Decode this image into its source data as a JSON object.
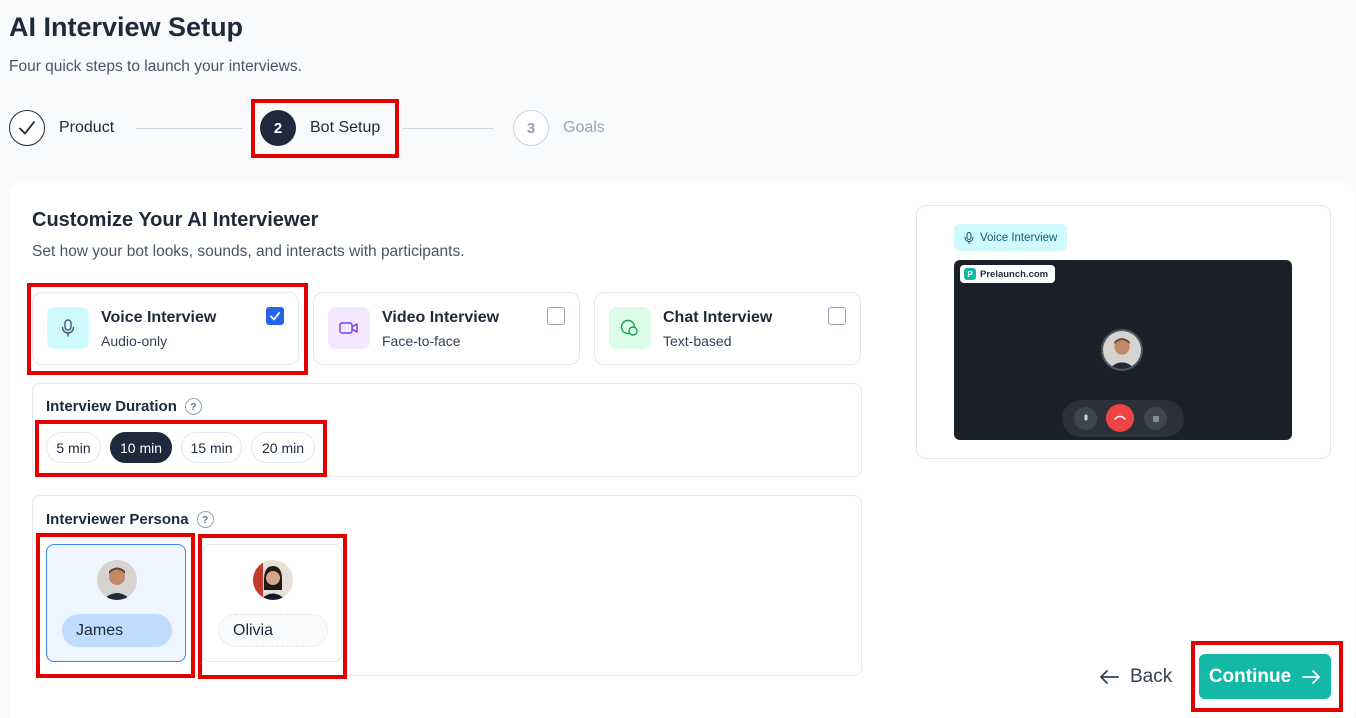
{
  "header": {
    "title": "AI Interview Setup",
    "subtitle": "Four quick steps to launch your interviews."
  },
  "stepper": {
    "steps": [
      {
        "number": "",
        "label": "Product",
        "state": "completed",
        "icon": "check-icon"
      },
      {
        "number": "2",
        "label": "Bot Setup",
        "state": "active"
      },
      {
        "number": "3",
        "label": "Goals",
        "state": "upcoming"
      }
    ]
  },
  "customize": {
    "title": "Customize Your AI Interviewer",
    "subtitle": "Set how your bot looks, sounds, and interacts with participants."
  },
  "modes": [
    {
      "title": "Voice Interview",
      "desc": "Audio-only",
      "icon": "microphone-icon",
      "checked": true,
      "icon_bg": "#cffafe"
    },
    {
      "title": "Video Interview",
      "desc": "Face-to-face",
      "icon": "video-camera-icon",
      "checked": false,
      "icon_bg": "#f3e8ff"
    },
    {
      "title": "Chat Interview",
      "desc": "Text-based",
      "icon": "chat-bubble-icon",
      "checked": false,
      "icon_bg": "#dcfce7"
    }
  ],
  "duration": {
    "label": "Interview Duration",
    "help": "?",
    "options": [
      "5 min",
      "10 min",
      "15 min",
      "20 min"
    ],
    "selected": "10 min"
  },
  "persona": {
    "label": "Interviewer Persona",
    "help": "?",
    "options": [
      {
        "name": "James",
        "selected": true
      },
      {
        "name": "Olivia",
        "selected": false
      }
    ]
  },
  "preview": {
    "badge": "Voice Interview",
    "brand": "Prelaunch.com",
    "brand_logo": "P"
  },
  "footer": {
    "back_label": "Back",
    "continue_label": "Continue"
  },
  "colors": {
    "accent": "#14b8a6",
    "dark": "#1e293b",
    "highlight": "#e30000",
    "selected_blue": "#2563eb"
  }
}
